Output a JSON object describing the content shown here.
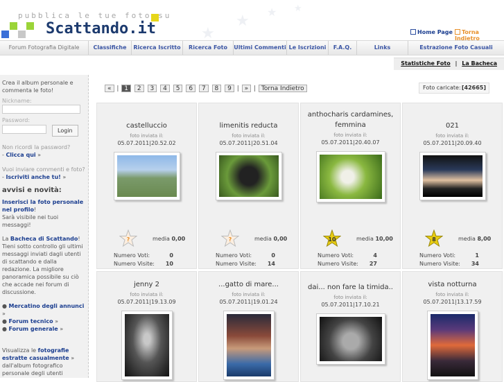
{
  "header": {
    "tagline": "pubblica le tue foto su",
    "brand": "Scattando.it",
    "home_link": "Home Page",
    "back_link": "Torna Indietro"
  },
  "nav": {
    "items": [
      "Forum Fotografia Digitale",
      "Classifiche",
      "Ricerca Iscritto",
      "Ricerca Foto",
      "Ultimi Commenti",
      "Le Iscrizioni",
      "F.A.Q.",
      "Links",
      "Estrazione Foto Casuali"
    ]
  },
  "subnav": {
    "stats": "Statistiche Foto",
    "sep": "|",
    "board": "La Bacheca"
  },
  "sidebar": {
    "intro": "Crea il album personale e commenta le foto!",
    "nickname_label": "Nickname:",
    "password_label": "Password:",
    "login": "Login",
    "forgot_q": "Non ricordi la password?",
    "forgot_link": "Clicca qui",
    "comment_q": "Vuoi inviare commenti e foto?",
    "register_link": "Iscriviti anche tu!",
    "news_title": "avvisi e novità:",
    "news_link": "Inserisci la foto personale nel profilo",
    "news_text": "Sarà visibile nei tuoi messaggi!",
    "board_pre": "La",
    "board_link": "Bacheca di Scattando",
    "board_text": "Tieni sotto controllo gli ultimi messaggi inviati dagli utenti di scattando e dalla redazione. La migliore panoramica possibile su ciò che accade nei forum di discussione.",
    "links": [
      "Mercatino degli annunci",
      "Forum tecnico",
      "Forum generale"
    ],
    "bottom_pre": "Visualizza le",
    "bottom_link": "fotografie estratte casualmente",
    "bottom_text": "dall'album fotografico personale degli utenti"
  },
  "pager": {
    "first": "«",
    "pages": [
      "1",
      "2",
      "3",
      "4",
      "5",
      "6",
      "7",
      "8",
      "9"
    ],
    "next": "»",
    "back": "Torna Indietro"
  },
  "counter": {
    "label": "Foto caricate:",
    "value": "[42665]"
  },
  "photos": [
    {
      "title": "castelluccio",
      "sent": "foto inviata il:",
      "date": "05.07.2011|20.52.02",
      "star": "?",
      "media": "0,00",
      "votes": "0",
      "visits": "10",
      "votes_label": "Numero Voti:",
      "visits_label": "Numero Visite:"
    },
    {
      "title": "limenitis reducta",
      "sent": "foto inviata il:",
      "date": "05.07.2011|20.51.04",
      "star": "?",
      "media": "0,00",
      "votes": "0",
      "visits": "14",
      "votes_label": "Numero Voti:",
      "visits_label": "Numero Visite:"
    },
    {
      "title": "anthocharis cardamines, femmina",
      "sent": "foto inviata il:",
      "date": "05.07.2011|20.40.07",
      "star": "10",
      "media": "10,00",
      "votes": "4",
      "visits": "27",
      "votes_label": "Numero Voti:",
      "visits_label": "Numero Visite:"
    },
    {
      "title": "021",
      "sent": "foto inviata il:",
      "date": "05.07.2011|20.09.40",
      "star": "8",
      "media": "8,00",
      "votes": "1",
      "visits": "34",
      "votes_label": "Numero Voti:",
      "visits_label": "Numero Visite:"
    },
    {
      "title": "jenny 2",
      "sent": "foto inviata il:",
      "date": "05.07.2011|19.13.09"
    },
    {
      "title": "...gatto di mare...",
      "sent": "foto inviata il:",
      "date": "05.07.2011|19.01.24"
    },
    {
      "title": "dai... non fare la timida..",
      "sent": "foto inviata il:",
      "date": "05.07.2011|17.10.21"
    },
    {
      "title": "vista notturna",
      "sent": "foto inviata il:",
      "date": "05.07.2011|13.17.59"
    }
  ],
  "media_label": "media",
  "colors": {
    "brand": "#1c3a6e",
    "link": "#1a3d8f",
    "star_gold": "#e8cc10",
    "star_empty": "#f5d3b0"
  }
}
